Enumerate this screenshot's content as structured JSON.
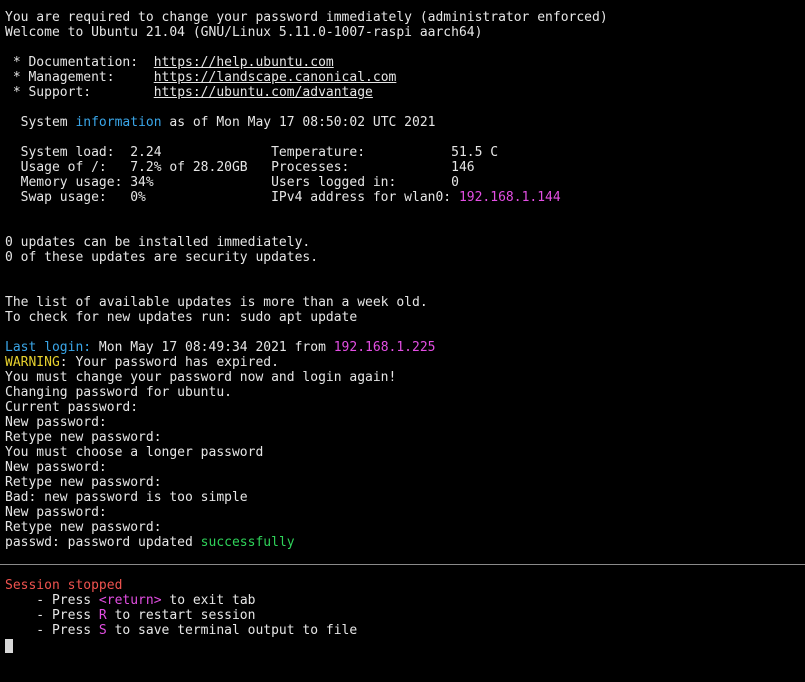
{
  "motd": {
    "force_change": "You are required to change your password immediately (administrator enforced)",
    "welcome": "Welcome to Ubuntu 21.04 (GNU/Linux 5.11.0-1007-raspi aarch64)",
    "doc_label": " * Documentation:  ",
    "doc_url": "https://help.ubuntu.com",
    "mgmt_label": " * Management:     ",
    "mgmt_url": "https://landscape.canonical.com",
    "support_label": " * Support:        ",
    "support_url": "https://ubuntu.com/advantage",
    "sysinfo_prefix": "  System ",
    "sysinfo_word": "information",
    "sysinfo_suffix": " as of Mon May 17 08:50:02 UTC 2021",
    "stats_row1": "  System load:  2.24              Temperature:           51.5 C",
    "stats_row2": "  Usage of /:   7.2% of 28.20GB   Processes:             146",
    "stats_row3": "  Memory usage: 34%               Users logged in:       0",
    "stats_row4_prefix": "  Swap usage:   0%                IPv4 address for wlan0: ",
    "ipv4_address": "192.168.1.144",
    "updates_1": "0 updates can be installed immediately.",
    "updates_2": "0 of these updates are security updates.",
    "stale_1": "The list of available updates is more than a week old.",
    "stale_2": "To check for new updates run: sudo apt update"
  },
  "login": {
    "last_login_label": "Last login:",
    "last_login_text": " Mon May 17 08:49:34 2021 from ",
    "last_login_ip": "192.168.1.225",
    "warning_label": "WARNING",
    "warning_text": ": Your password has expired.",
    "must_change": "You must change your password now and login again!",
    "changing": "Changing password for ubuntu.",
    "current_pw": "Current password:",
    "new_pw_1": "New password:",
    "retype_1": "Retype new password:",
    "longer": "You must choose a longer password",
    "new_pw_2": "New password:",
    "retype_2": "Retype new password:",
    "too_simple": "Bad: new password is too simple",
    "new_pw_3": "New password:",
    "retype_3": "Retype new password:",
    "updated_prefix": "passwd: password updated ",
    "updated_word": "successfully"
  },
  "session": {
    "stopped": "Session stopped",
    "press_prefix": "    - Press ",
    "return_key": "<return>",
    "return_text": " to exit tab",
    "r_key": "R",
    "r_text": " to restart session",
    "s_key": "S",
    "s_text": " to save terminal output to file"
  },
  "colors": {
    "background": "#000000",
    "foreground": "#e6e6e6",
    "blue": "#3aa6e8",
    "magenta": "#e34ee3",
    "yellow": "#e6d12e",
    "green": "#2fd35a",
    "red": "#f0534f"
  }
}
